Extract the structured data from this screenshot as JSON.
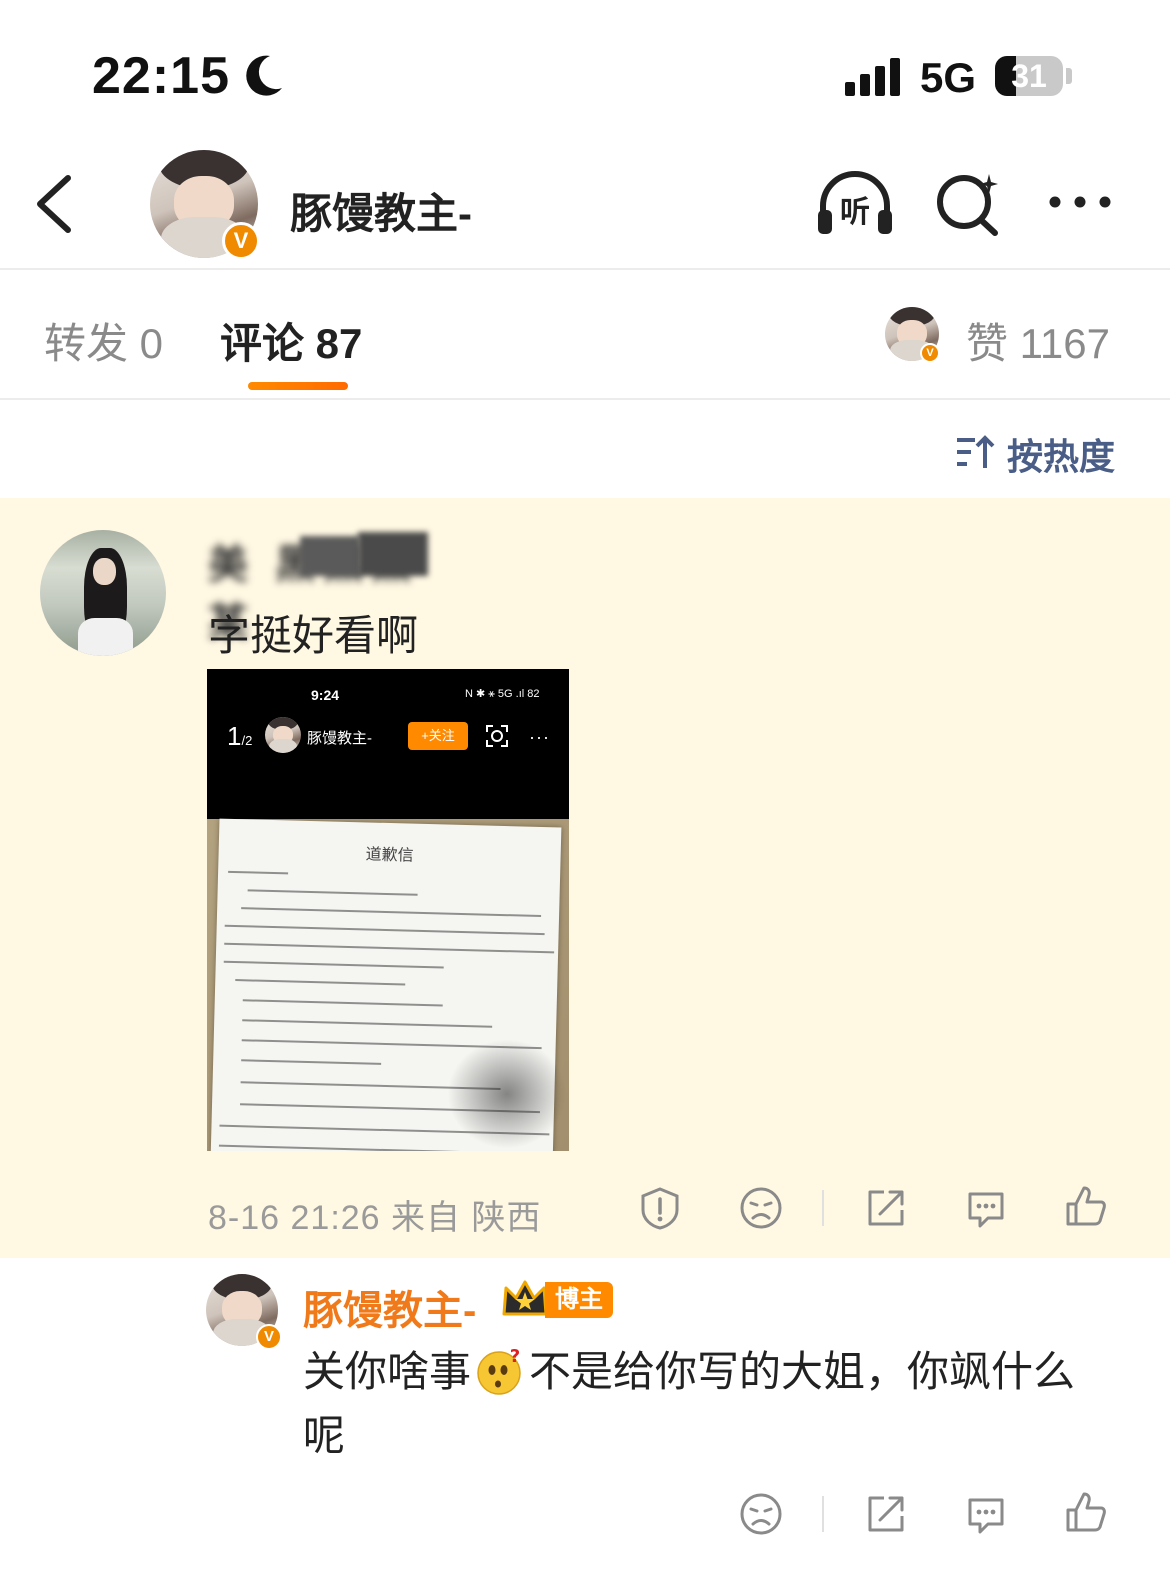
{
  "status_bar": {
    "time": "22:15",
    "network": "5G",
    "battery": "31"
  },
  "header": {
    "title": "豚馒教主-",
    "verified_badge": "V"
  },
  "tabs": {
    "repost": "转发 0",
    "comment": "评论 87",
    "likes": "赞 1167"
  },
  "sort": {
    "label": "按热度"
  },
  "comment": {
    "username": "美 黑黑黑某",
    "text": "字挺好看啊",
    "image": {
      "time": "9:24",
      "status_icons": "N ✱ ⚹ 5G .ıl 82",
      "page": "1",
      "page_total": "/2",
      "name": "豚馒教主-",
      "follow_label": "+关注",
      "more": "···",
      "letter_title": "道歉信"
    },
    "meta": "8-16 21:26 来自 陕西"
  },
  "reply": {
    "username": "豚馒教主-",
    "badge": "博主",
    "text_before": "关你啥事",
    "text_after": "不是给你写的大姐，你飒什么呢"
  },
  "colors": {
    "accent": "#ff8a00",
    "highlight_bg": "#fff8e3",
    "reply_name": "#f07a1a",
    "sort_blue": "#4a5d86"
  }
}
